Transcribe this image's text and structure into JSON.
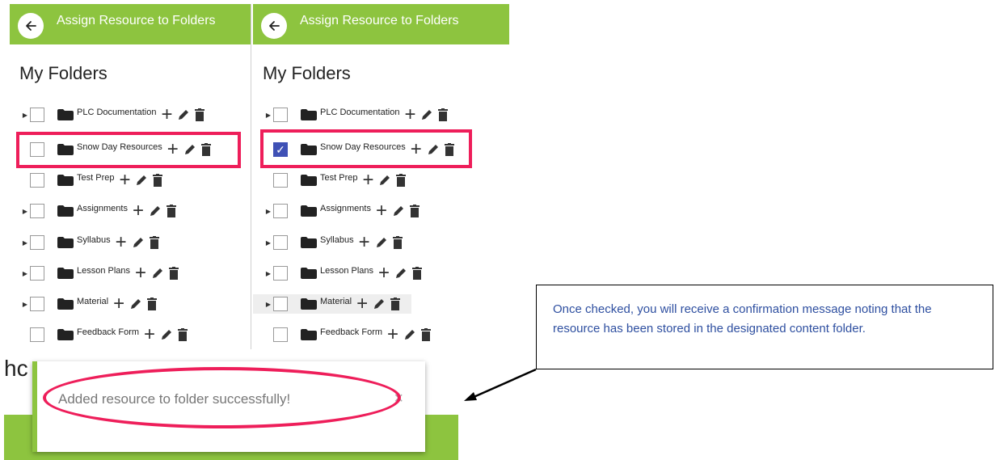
{
  "header": {
    "title": "Assign Resource to Folders",
    "back_icon": "arrow-left-icon"
  },
  "heading": "My Folders",
  "folders_left": [
    {
      "label": "PLC Documentation",
      "has_children": true,
      "checked": false
    },
    {
      "label": "Snow Day Resources",
      "has_children": false,
      "checked": false
    },
    {
      "label": "Test Prep",
      "has_children": false,
      "checked": false
    },
    {
      "label": "Assignments",
      "has_children": true,
      "checked": false
    },
    {
      "label": "Syllabus",
      "has_children": true,
      "checked": false
    },
    {
      "label": "Lesson Plans",
      "has_children": true,
      "checked": false
    },
    {
      "label": "Material",
      "has_children": true,
      "checked": false
    },
    {
      "label": "Feedback Form",
      "has_children": false,
      "checked": false
    }
  ],
  "folders_right": [
    {
      "label": "PLC Documentation",
      "has_children": true,
      "checked": false
    },
    {
      "label": "Snow Day Resources",
      "has_children": false,
      "checked": true
    },
    {
      "label": "Test Prep",
      "has_children": false,
      "checked": false
    },
    {
      "label": "Assignments",
      "has_children": true,
      "checked": false
    },
    {
      "label": "Syllabus",
      "has_children": true,
      "checked": false
    },
    {
      "label": "Lesson Plans",
      "has_children": true,
      "checked": false
    },
    {
      "label": "Material",
      "has_children": true,
      "checked": false
    },
    {
      "label": "Feedback Form",
      "has_children": false,
      "checked": false
    }
  ],
  "footer_partial_text": "hc",
  "toast": {
    "message": "Added resource to folder successfully!",
    "close": "×"
  },
  "callout": {
    "text": "Once checked, you will receive a confirmation message noting that the resource has been stored in the designated content folder."
  },
  "colors": {
    "brand_green": "#8dc43f",
    "highlight_red": "#ee1e5a",
    "checkbox_blue": "#3f51b5",
    "callout_text": "#2e4fa0"
  }
}
